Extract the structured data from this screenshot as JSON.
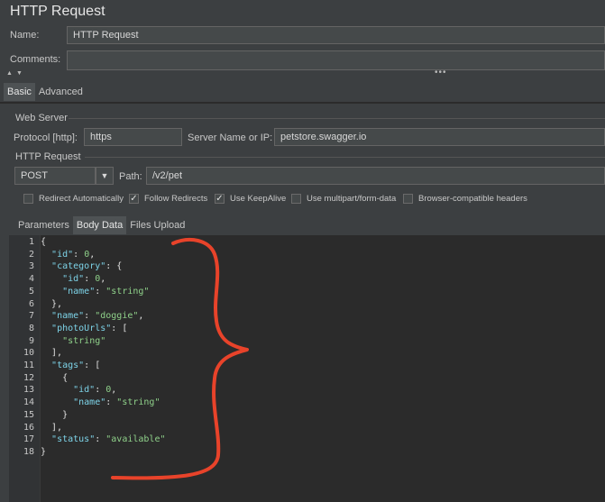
{
  "window": {
    "title": "HTTP Request"
  },
  "name_field": {
    "label": "Name:",
    "value": "HTTP Request"
  },
  "comments_field": {
    "label": "Comments:",
    "value": ""
  },
  "tabs": [
    {
      "label": "Basic"
    },
    {
      "label": "Advanced"
    }
  ],
  "web_server": {
    "group_label": "Web Server",
    "protocol_label": "Protocol [http]:",
    "protocol_value": "https",
    "server_label": "Server Name or IP:",
    "server_value": "petstore.swagger.io"
  },
  "http_request": {
    "group_label": "HTTP Request",
    "method_value": "POST",
    "path_label": "Path:",
    "path_value": "/v2/pet"
  },
  "options": [
    {
      "label": "Redirect Automatically",
      "checked": false
    },
    {
      "label": "Follow Redirects",
      "checked": true
    },
    {
      "label": "Use KeepAlive",
      "checked": true
    },
    {
      "label": "Use multipart/form-data",
      "checked": false
    },
    {
      "label": "Browser-compatible headers",
      "checked": false
    }
  ],
  "subtabs": [
    {
      "label": "Parameters"
    },
    {
      "label": "Body Data"
    },
    {
      "label": "Files Upload"
    }
  ],
  "body": {
    "line_numbers": [
      "1",
      "2",
      "3",
      "4",
      "5",
      "6",
      "7",
      "8",
      "9",
      "10",
      "11",
      "12",
      "13",
      "14",
      "15",
      "16",
      "17",
      "18"
    ],
    "lines": [
      "{",
      "  \"id\": 0,",
      "  \"category\": {",
      "    \"id\": 0,",
      "    \"name\": \"string\"",
      "  },",
      "  \"name\": \"doggie\",",
      "  \"photoUrls\": [",
      "    \"string\"",
      "  ],",
      "  \"tags\": [",
      "    {",
      "      \"id\": 0,",
      "      \"name\": \"string\"",
      "    }",
      "  ],",
      "  \"status\": \"available\"",
      "}"
    ]
  },
  "colors": {
    "annotation": "#e8432a"
  }
}
